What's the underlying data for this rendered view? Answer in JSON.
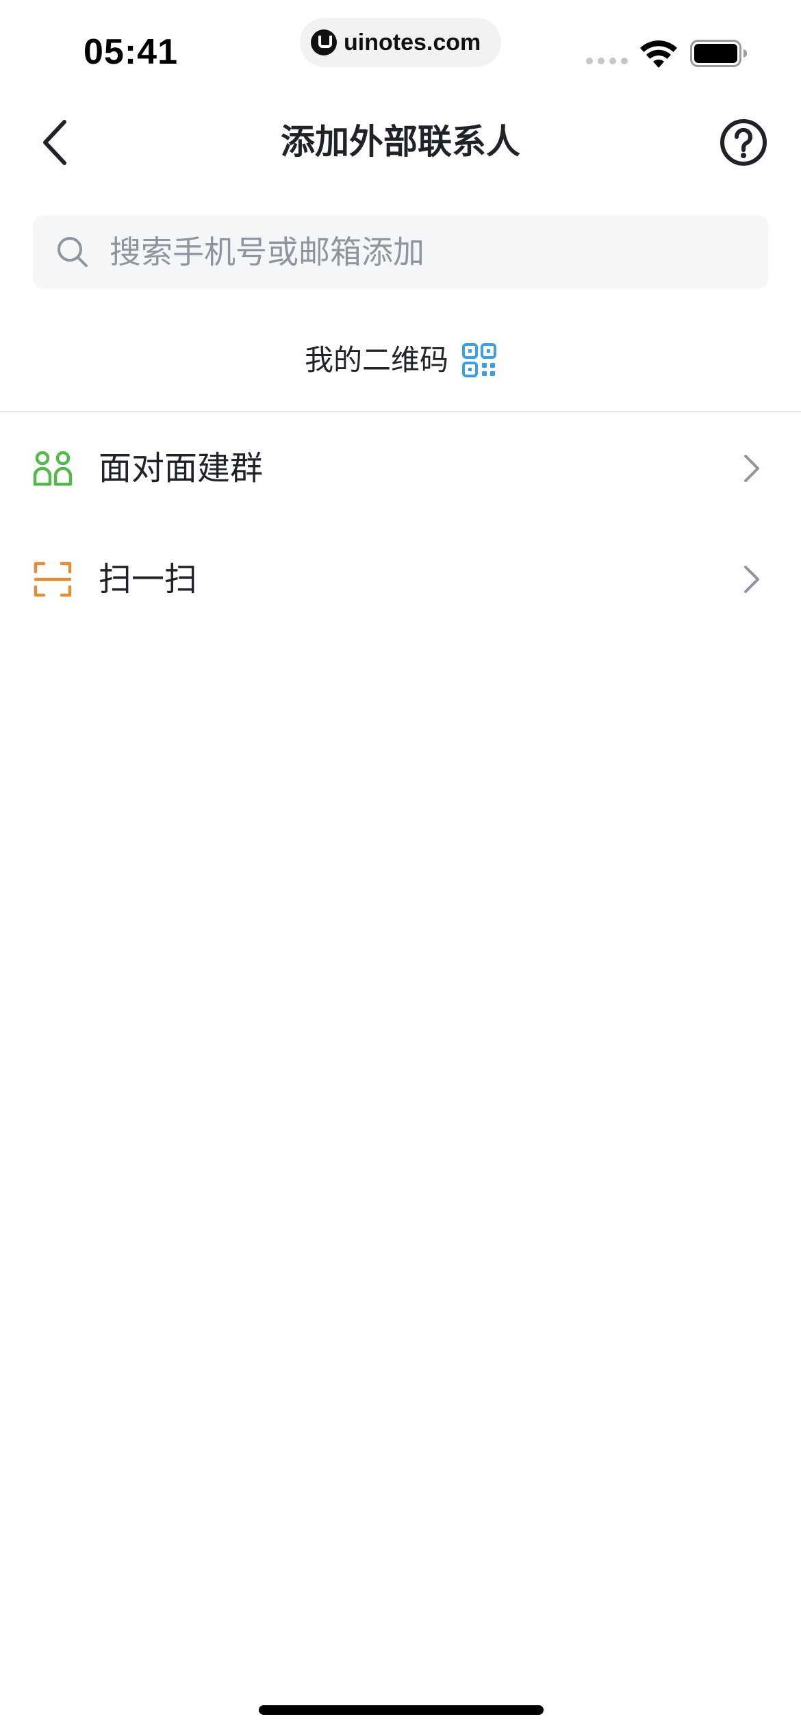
{
  "status_bar": {
    "time": "05:41",
    "url": "uinotes.com"
  },
  "nav": {
    "title": "添加外部联系人",
    "back_icon": "chevron-left-icon",
    "help_icon": "question-circle-icon"
  },
  "search": {
    "placeholder": "搜索手机号或邮箱添加",
    "value": "",
    "icon": "search-icon"
  },
  "my_qr": {
    "label": "我的二维码",
    "icon": "qr-code-icon",
    "icon_color": "#3d9ee5"
  },
  "list": {
    "items": [
      {
        "label": "面对面建群",
        "icon": "people-pair-icon",
        "icon_color": "#55b84a"
      },
      {
        "label": "扫一扫",
        "icon": "scan-icon",
        "icon_color": "#e08e3a"
      }
    ]
  },
  "colors": {
    "text_primary": "#1f2329",
    "text_placeholder": "#8f959e",
    "search_bg": "#f5f6f7",
    "divider": "#e8e9eb",
    "chevron": "#8f959e"
  }
}
